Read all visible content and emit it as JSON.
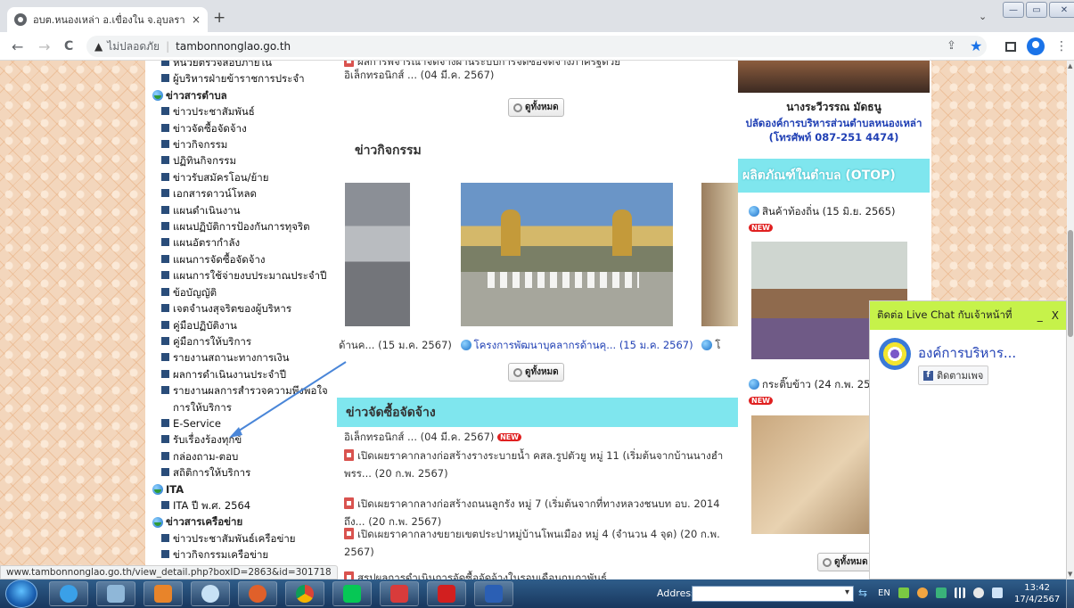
{
  "browser": {
    "tab_title": "อบต.หนองเหล่า อ.เขื่องใน จ.อุบลราชธา",
    "tab_close": "×",
    "new_tab": "+",
    "tab_dropdown": "⌄",
    "win_controls": [
      "—",
      "▭",
      "✕"
    ],
    "nav_back": "←",
    "nav_forward": "→",
    "nav_reload": "C",
    "security_icon": "▲",
    "security_text": "ไม่ปลอดภัย",
    "separator": "|",
    "url": "tambonnonglao.go.th",
    "share_icon": "⇪",
    "star_icon": "★",
    "menu_icon": "⋮",
    "status_url": "www.tambonnonglao.go.th/view_detail.php?boxID=2863&id=301718"
  },
  "left_menu": [
    {
      "type": "item",
      "label": "หน่วยตรวจสอบภายใน"
    },
    {
      "type": "item",
      "label": "ผู้บริหารฝ่ายข้าราชการประจำ"
    },
    {
      "type": "head",
      "label": "ข่าวสารตำบล"
    },
    {
      "type": "item",
      "label": "ข่าวประชาสัมพันธ์"
    },
    {
      "type": "item",
      "label": "ข่าวจัดซื้อจัดจ้าง"
    },
    {
      "type": "item",
      "label": "ข่าวกิจกรรม"
    },
    {
      "type": "item",
      "label": "ปฏิทินกิจกรรม"
    },
    {
      "type": "item",
      "label": "ข่าวรับสมัครโอน/ย้าย"
    },
    {
      "type": "item",
      "label": "เอกสารดาวน์โหลด"
    },
    {
      "type": "item",
      "label": "แผนดำเนินงาน"
    },
    {
      "type": "item",
      "label": "แผนปฏิบัติการป้องกันการทุจริต"
    },
    {
      "type": "item",
      "label": "แผนอัตรากำลัง"
    },
    {
      "type": "item",
      "label": "แผนการจัดซื้อจัดจ้าง"
    },
    {
      "type": "item",
      "label": "แผนการใช้จ่ายงบประมาณประจำปี"
    },
    {
      "type": "item",
      "label": "ข้อบัญญัติ"
    },
    {
      "type": "item",
      "label": "เจตจำนงสุจริตของผู้บริหาร"
    },
    {
      "type": "item",
      "label": "คู่มือปฏิบัติงาน"
    },
    {
      "type": "item",
      "label": "คู่มือการให้บริการ"
    },
    {
      "type": "item",
      "label": "รายงานสถานะทางการเงิน"
    },
    {
      "type": "item",
      "label": "ผลการดำเนินงานประจำปี"
    },
    {
      "type": "item",
      "label": "รายงานผลการสำรวจความพึงพอใจการให้บริการ"
    },
    {
      "type": "item",
      "label": "E-Service"
    },
    {
      "type": "item",
      "label": "รับเรื่องร้องทุกข์"
    },
    {
      "type": "item",
      "label": "กล่องถาม-ตอบ"
    },
    {
      "type": "item",
      "label": "สถิติการให้บริการ"
    },
    {
      "type": "head",
      "label": "ITA"
    },
    {
      "type": "item",
      "label": "ITA ปี พ.ศ. 2564"
    },
    {
      "type": "head",
      "label": "ข่าวสารเครือข่าย"
    },
    {
      "type": "item",
      "label": "ข่าวประชาสัมพันธ์เครือข่าย"
    },
    {
      "type": "item",
      "label": "ข่าวกิจกรรมเครือข่าย"
    }
  ],
  "center": {
    "top_news_line1": "ผลการพิจารณาจัดจ้างผ่านระบบการจัดซื้อจัดจ้างภาครัฐด้วย",
    "top_news_line2": "อิเล็กทรอนิกส์ ... (04 มี.ค. 2567)",
    "view_all_label": "ดูทั้งหมด",
    "activity_title": "ข่าวกิจกรรม",
    "activity_caption_prefix": "ด้านค... (15 ม.ค. 2567)",
    "activity_caption_link": "โครงการพัฒนาบุคลากรด้านคุ... (15 ม.ค. 2567)",
    "activity_caption_suffix": "โ",
    "procurement_title": "ข่าวจัดซื้อจัดจ้าง",
    "procurement_partial": "อิเล็กทรอนิกส์ ... (04 มี.ค. 2567)",
    "new_badge": "NEW",
    "procurement_items": [
      "เปิดเผยราคากลางก่อสร้างรางระบายน้ำ คสล.รูปตัวยู หมู่ 11 (เริ่มต้นจากบ้านนางฮำพรร... (20 ก.พ. 2567)",
      "เปิดเผยราคากลางก่อสร้างถนนลูกรัง หมู่ 7 (เริ่มต้นจากที่ทางหลวงชนบท อบ. 2014 ถึง... (20 ก.พ. 2567)",
      "เปิดเผยราคากลางขยายเขตประปาหมู่บ้านโพนเมือง หมู่ 4 (จำนวน 4 จุด) (20 ก.พ. 2567)",
      "สรุปผลการดำเนินการจัดซื้อจัดจ้างในรอบเดือนกุมภาพันธ์"
    ]
  },
  "right": {
    "person_name": "นางระวีวรรณ มัดธนู",
    "person_title": "ปลัดองค์การบริหารส่วนตำบลหนองเหล่า (โทรศัพท์ 087-251 4474)",
    "otop_title": "ผลิตภัณฑ์ในตำบล (OTOP)",
    "otop_item1": "สินค้าท้องถิ่น (15 มิ.ย. 2565)",
    "otop_item2": "กระติ๊บข้าว (24 ก.พ. 25",
    "view_all_label": "ดูทั้งหมด",
    "new_badge": "NEW"
  },
  "live_chat": {
    "title": "ติดต่อ Live Chat กับเจ้าหน้าที่",
    "minimize": "_",
    "close": "X",
    "org_name": "องค์การบริหาร...",
    "follow_label": "ติดตามเพจ",
    "fb_glyph": "f"
  },
  "taskbar": {
    "address_label": "Address",
    "go_icon": "⇆",
    "lang": "EN",
    "time": "13:42",
    "date": "17/4/2567"
  },
  "colors": {
    "cyan_bar": "#7fe6ee",
    "chat_header": "#c6f24a",
    "link_blue": "#1f3fb4",
    "arrow": "#4a86d8"
  }
}
